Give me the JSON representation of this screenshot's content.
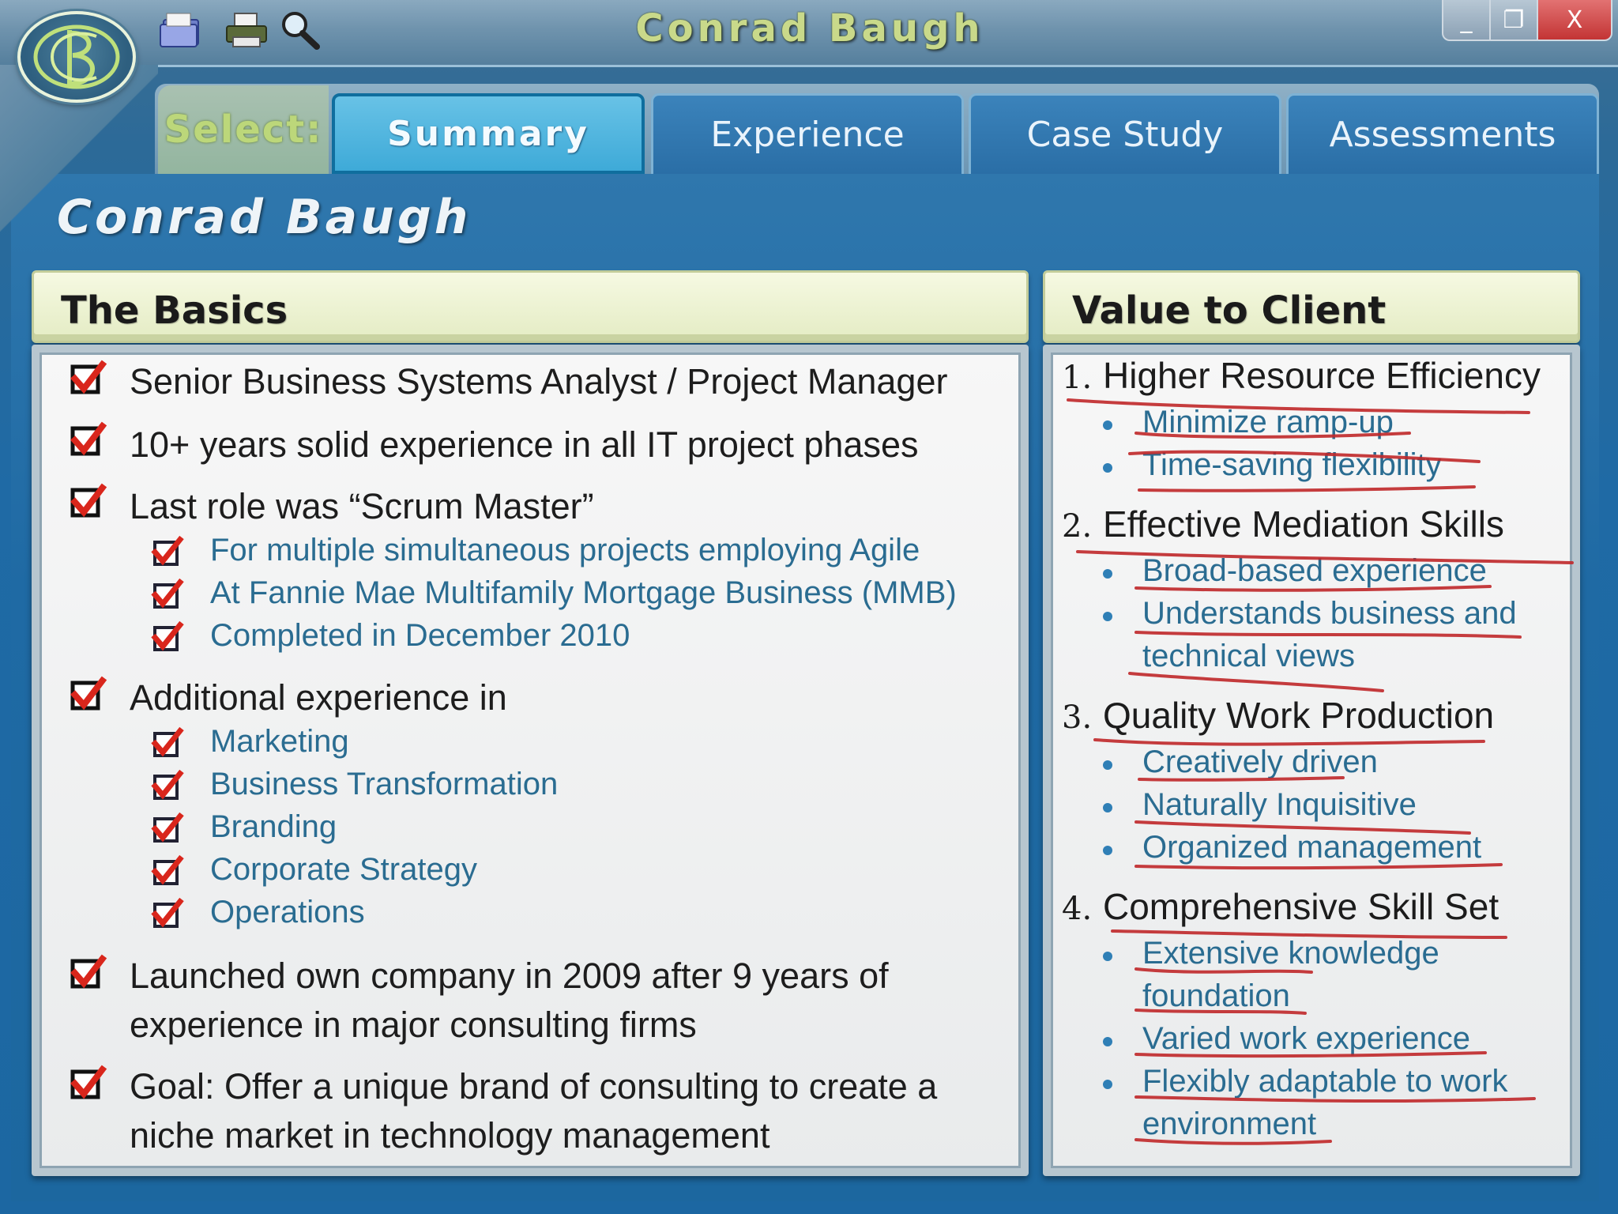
{
  "window": {
    "title": "Conrad Baugh",
    "minimize_label": "_",
    "maximize_label": "❐",
    "close_label": "X"
  },
  "tabs": {
    "select_label": "Select:",
    "items": [
      {
        "label": "Summary",
        "active": true
      },
      {
        "label": "Experience",
        "active": false
      },
      {
        "label": "Case Study",
        "active": false
      },
      {
        "label": "Assessments",
        "active": false
      }
    ]
  },
  "page": {
    "title": "Conrad Baugh"
  },
  "basics": {
    "heading": "The Basics",
    "items": [
      "Senior Business Systems Analyst / Project Manager",
      "10+ years solid experience in all IT project phases",
      "Last role was “Scrum Master”",
      "For multiple simultaneous  projects employing Agile",
      "At Fannie Mae Multifamily Mortgage Business (MMB)",
      "Completed in December  2010",
      "Additional experience in",
      "Marketing",
      "Business Transformation",
      "Branding",
      "Corporate Strategy",
      "Operations",
      "Launched own company in 2009 after 9 years of",
      "experience in major consulting firms",
      "Goal:  Offer a unique brand of consulting to create a",
      "niche market in technology management"
    ]
  },
  "value": {
    "heading": "Value to Client",
    "groups": [
      {
        "num": "1.",
        "title": "Higher Resource Efficiency",
        "items": [
          "Minimize ramp-up",
          "Time-saving flexibility"
        ]
      },
      {
        "num": "2.",
        "title": "Effective Mediation Skills",
        "items": [
          "Broad-based experience",
          "Understands business and",
          "technical views"
        ]
      },
      {
        "num": "3.",
        "title": "Quality Work Production",
        "items": [
          "Creatively driven",
          "Naturally Inquisitive",
          "Organized management"
        ]
      },
      {
        "num": "4.",
        "title": "Comprehensive Skill Set",
        "items": [
          "Extensive knowledge",
          "foundation",
          "Varied work experience",
          "Flexibly adaptable to work",
          "environment"
        ]
      }
    ]
  },
  "colors": {
    "accent_check": "#d9261c",
    "sub_text": "#2a6c91",
    "ink_underline": "#c0282a"
  }
}
